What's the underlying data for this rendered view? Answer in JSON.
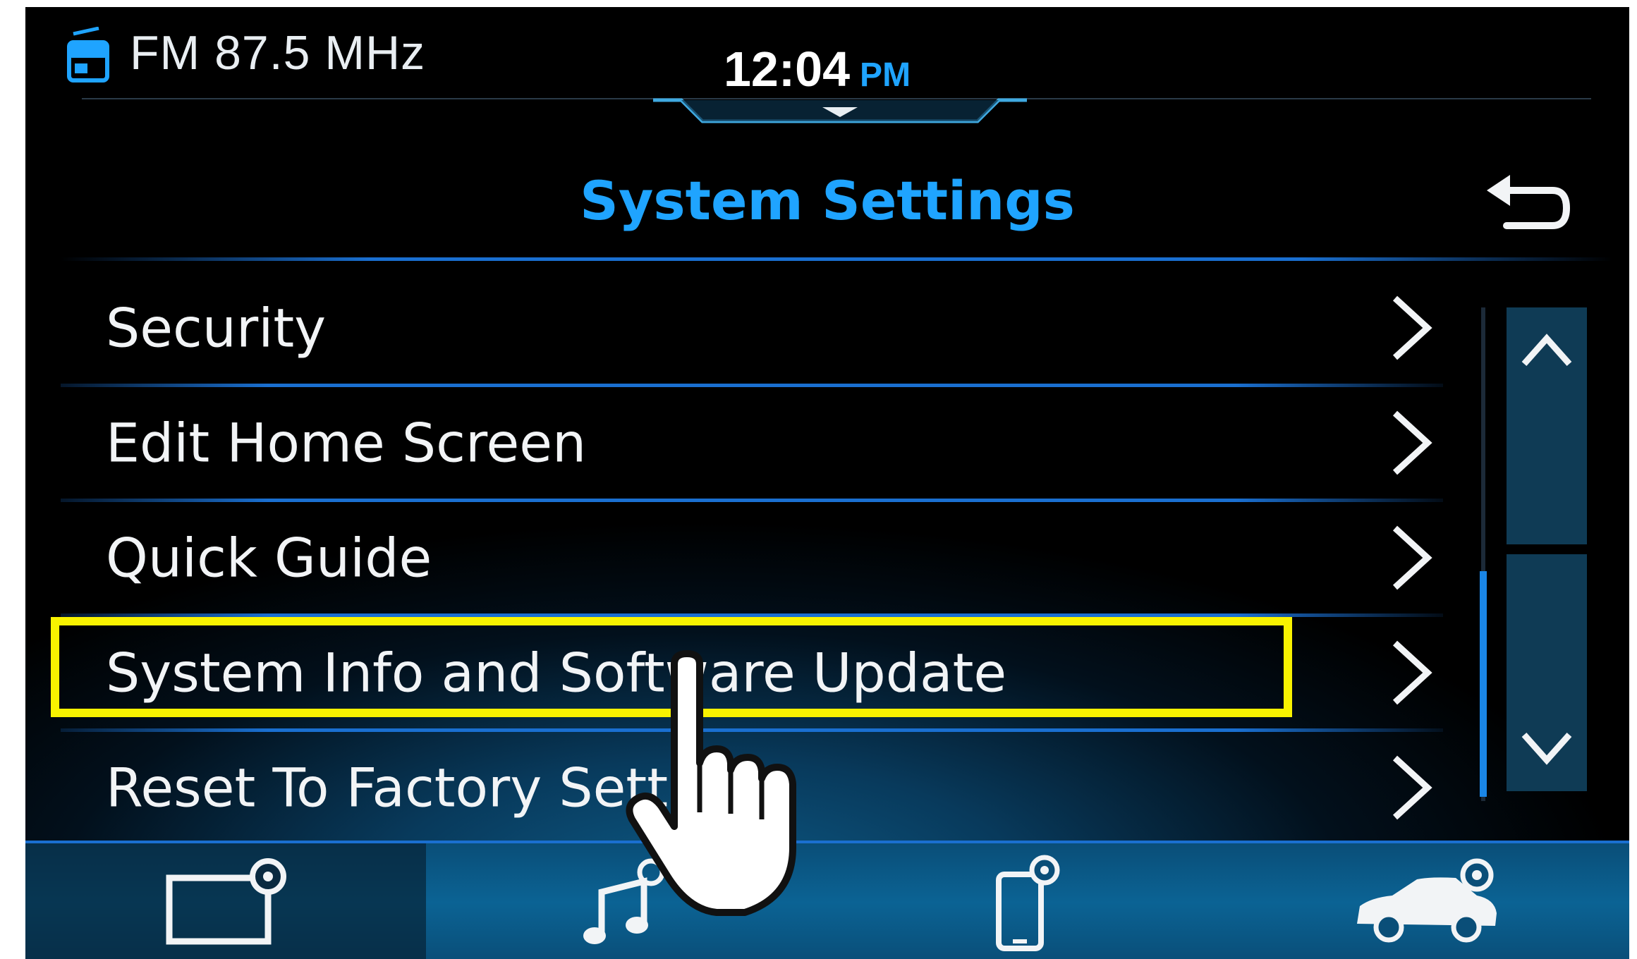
{
  "status": {
    "radio_icon": "radio-icon",
    "frequency": "FM 87.5 MHz",
    "time": "12:04",
    "ampm": "PM"
  },
  "header": {
    "title": "System Settings",
    "back_icon": "back-arrow-icon"
  },
  "menu": {
    "items": [
      {
        "label": "Security"
      },
      {
        "label": "Edit Home Screen"
      },
      {
        "label": "Quick Guide"
      },
      {
        "label": "System Info and Software Update",
        "highlighted": true
      },
      {
        "label": "Reset To Factory Settings"
      }
    ]
  },
  "scroll": {
    "up_icon": "chevron-up-icon",
    "down_icon": "chevron-down-icon"
  },
  "bottom_tabs": [
    {
      "icon": "display-settings-icon",
      "active": true
    },
    {
      "icon": "sound-settings-icon"
    },
    {
      "icon": "phone-settings-icon"
    },
    {
      "icon": "vehicle-settings-icon"
    }
  ],
  "overlay": {
    "icon": "pointing-hand-icon"
  },
  "colors": {
    "accent": "#1fa4ff",
    "highlight": "#f8f200",
    "text": "#f2f4f6"
  }
}
